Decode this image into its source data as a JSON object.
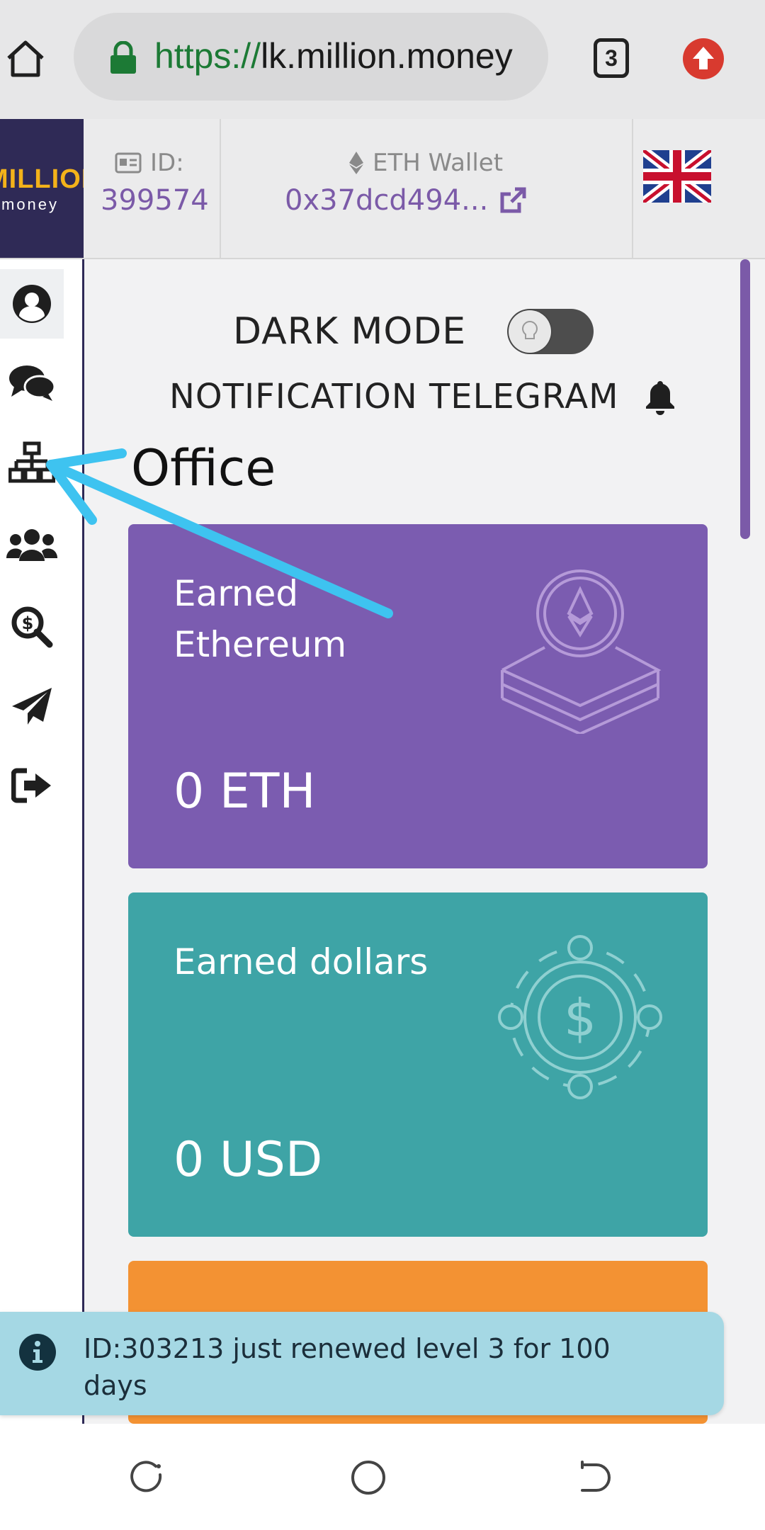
{
  "browser": {
    "url_scheme": "https://",
    "url_host": "lk.million.money",
    "tab_count": "3",
    "icons": [
      "home-icon",
      "lock-icon",
      "tabs-icon",
      "upload-icon"
    ]
  },
  "header": {
    "logo_text": "MILLION",
    "logo_sub": "money",
    "id_label": "ID:",
    "id_value": "399574",
    "wallet_label": "ETH Wallet",
    "wallet_value": "0x37dcd494...",
    "language_flag": "uk-flag-icon"
  },
  "sidebar": {
    "items": [
      {
        "name": "profile",
        "icon": "user-circle-icon",
        "active": true
      },
      {
        "name": "chat",
        "icon": "chat-bubbles-icon",
        "active": false
      },
      {
        "name": "structure",
        "icon": "sitemap-icon",
        "active": false
      },
      {
        "name": "partners",
        "icon": "users-icon",
        "active": false
      },
      {
        "name": "search-dollar",
        "icon": "search-dollar-icon",
        "active": false
      },
      {
        "name": "telegram",
        "icon": "paper-plane-icon",
        "active": false
      },
      {
        "name": "logout",
        "icon": "sign-out-icon",
        "active": false
      }
    ]
  },
  "main": {
    "dark_mode_label": "DARK MODE",
    "dark_mode_on": false,
    "notification_label": "NOTIFICATION TELEGRAM",
    "office_title": "Office",
    "cards": [
      {
        "title": "Earned Ethereum",
        "value": "0 ETH",
        "color": "#7b5cb0",
        "icon": "ethereum-coins-icon"
      },
      {
        "title": "Earned dollars",
        "value": "0 USD",
        "color": "#3ea4a6",
        "icon": "dollar-cycle-icon"
      },
      {
        "title": "",
        "value": "",
        "color": "#f39233",
        "icon": "card-icon"
      }
    ]
  },
  "toast": {
    "text": "ID:303213 just renewed level 3 for 100 days",
    "icon": "info-circle-icon"
  },
  "nav": {
    "buttons": [
      "recent-apps-icon",
      "home-circle-icon",
      "back-icon"
    ]
  },
  "colors": {
    "accent": "#7b5aa8",
    "annotation_arrow": "#3ec3f0",
    "brand_dark": "#2f2a56",
    "brand_gold": "#f3b21a"
  }
}
